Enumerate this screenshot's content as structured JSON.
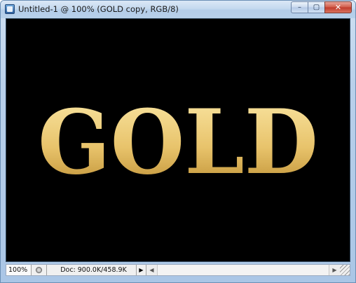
{
  "window": {
    "title": "Untitled-1 @ 100% (GOLD copy, RGB/8)",
    "app_icon": "photoshop-document-icon",
    "buttons": {
      "minimize_glyph": "–",
      "maximize_glyph": "▢",
      "close_glyph": "✕"
    }
  },
  "canvas": {
    "background": "#000000",
    "text": "GOLD",
    "gradient_top": "#fbe9a8",
    "gradient_mid": "#e8c36b",
    "gradient_bottom": "#b98a2e"
  },
  "status_bar": {
    "zoom": "100%",
    "doc_info": "Doc: 900.0K/458.9K",
    "menu_arrow_icon": "play-arrow-icon",
    "menu_arrow_glyph": "▶",
    "scroll_left_glyph": "◀",
    "scroll_right_glyph": "▶"
  }
}
